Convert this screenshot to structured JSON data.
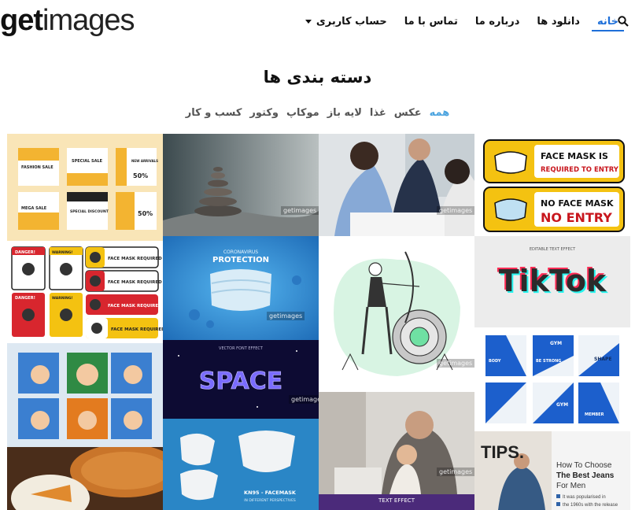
{
  "header": {
    "logo_part1": "get",
    "logo_part2": "images",
    "nav": [
      {
        "label": "خانه",
        "active": true
      },
      {
        "label": "دانلود ها",
        "active": false
      },
      {
        "label": "درباره ما",
        "active": false
      },
      {
        "label": "تماس با ما",
        "active": false
      },
      {
        "label": "حساب کاربری",
        "active": false
      }
    ]
  },
  "page_title": "دسته بندی ها",
  "filters": [
    "همه",
    "عکس",
    "غذا",
    "لایه باز",
    "موکاپ",
    "وکتور",
    "کسب و کار"
  ],
  "tiles": {
    "fashion_sale": {
      "t1": "FASHION SALE",
      "t2": "SPECIAL SALE",
      "t3": "NEW ARRIVALS",
      "t4": "50%",
      "t5": "MEGA SALE",
      "t6": "SPECIAL DISCOUNT",
      "t7": "50%"
    },
    "mask_entry": {
      "line1": "FACE MASK IS",
      "line2": "REQUIRED TO ENTRY",
      "line3": "NO FACE MASK",
      "line4": "NO ENTRY"
    },
    "danger_signs": {
      "danger": "DANGER!",
      "warning": "WARNING!",
      "fmr": "FACE MASK REQUIRED"
    },
    "protection": {
      "small": "CORONAVIRUS",
      "big": "PROTECTION"
    },
    "space": {
      "small": "VECTOR FONT EFFECT",
      "big": "SPACE"
    },
    "tiktok": {
      "small": "EDITABLE TEXT EFFECT",
      "big": "TikTok"
    },
    "gym": {
      "g1": "GYM",
      "g2": "BODY",
      "g3": "SHAPE",
      "g4": "BE STRONG",
      "g5": "GYM",
      "g6": "MEMBER"
    },
    "kn95": {
      "label": "KN95 - FACEMASK",
      "sub": "IN DIFFERENT PERSPECTIVES"
    },
    "tips": {
      "big": "TIPS.",
      "h1": "How To Choose",
      "h2": "The Best Jeans",
      "h3": "For Men",
      "p1": "It was popularised in",
      "p2": "the 1960s with the release"
    },
    "text_effect": "TEXT EFFECT",
    "watermark": "getimages"
  },
  "colors": {
    "accent": "#1e6fd9",
    "filter_active": "#4aa3df"
  }
}
